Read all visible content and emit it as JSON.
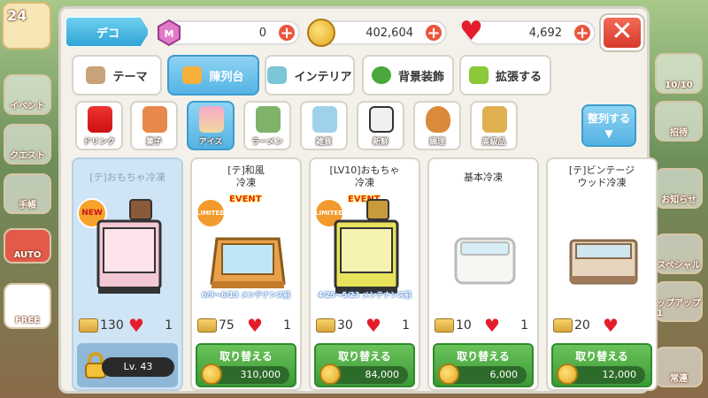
{
  "level_badge": "24",
  "left_menu": [
    "イベント",
    "クエスト",
    "手帳",
    "AUTO",
    "FREE"
  ],
  "right_menu": [
    "10/10",
    "招待",
    "お知らせ",
    "スペシャル",
    "ップアップ1",
    "常連"
  ],
  "topbar": {
    "deco_label": "デコ",
    "gem_count": "0",
    "coin_count": "402,604",
    "heart_count": "4,692"
  },
  "tabs": [
    {
      "label": "テーマ",
      "active": false
    },
    {
      "label": "陳列台",
      "active": true
    },
    {
      "label": "インテリア",
      "active": false
    },
    {
      "label": "背景装飾",
      "active": false
    },
    {
      "label": "拡張する",
      "active": false
    }
  ],
  "categories": [
    {
      "label": "ドリンク",
      "active": false
    },
    {
      "label": "菓子",
      "active": false
    },
    {
      "label": "アイス",
      "active": true
    },
    {
      "label": "ラーメン",
      "active": false
    },
    {
      "label": "雑貨",
      "active": false
    },
    {
      "label": "新鮮",
      "active": false
    },
    {
      "label": "調理",
      "active": false
    },
    {
      "label": "高級品",
      "active": false
    }
  ],
  "sort_label": "整列する",
  "cards": [
    {
      "title": "[テ]おもちゃ冷凍",
      "badge": "NEW",
      "event": "",
      "note": "",
      "score": "130",
      "hearts": "1",
      "locked": true,
      "level": "Lv. 43",
      "button": "",
      "price": ""
    },
    {
      "title": "[テ]和風\n冷凍",
      "badge": "LIMITED",
      "event": "EVENT",
      "note": "6/9～6/13 メンテナンス前",
      "score": "75",
      "hearts": "1",
      "locked": false,
      "level": "",
      "button": "取り替える",
      "price": "310,000"
    },
    {
      "title": "[LV10]おもちゃ\n冷凍",
      "badge": "LIMITED",
      "event": "EVENT",
      "note": "4/25～5/23 メンテナンス前",
      "score": "30",
      "hearts": "1",
      "locked": false,
      "level": "",
      "button": "取り替える",
      "price": "84,000"
    },
    {
      "title": "基本冷凍",
      "badge": "",
      "event": "",
      "note": "",
      "score": "10",
      "hearts": "1",
      "locked": false,
      "level": "",
      "button": "取り替える",
      "price": "6,000"
    },
    {
      "title": "[テ]ビンテージ\nウッド冷凍",
      "badge": "",
      "event": "",
      "note": "",
      "score": "20",
      "hearts": "",
      "locked": false,
      "level": "",
      "button": "取り替える",
      "price": "12,000"
    }
  ]
}
